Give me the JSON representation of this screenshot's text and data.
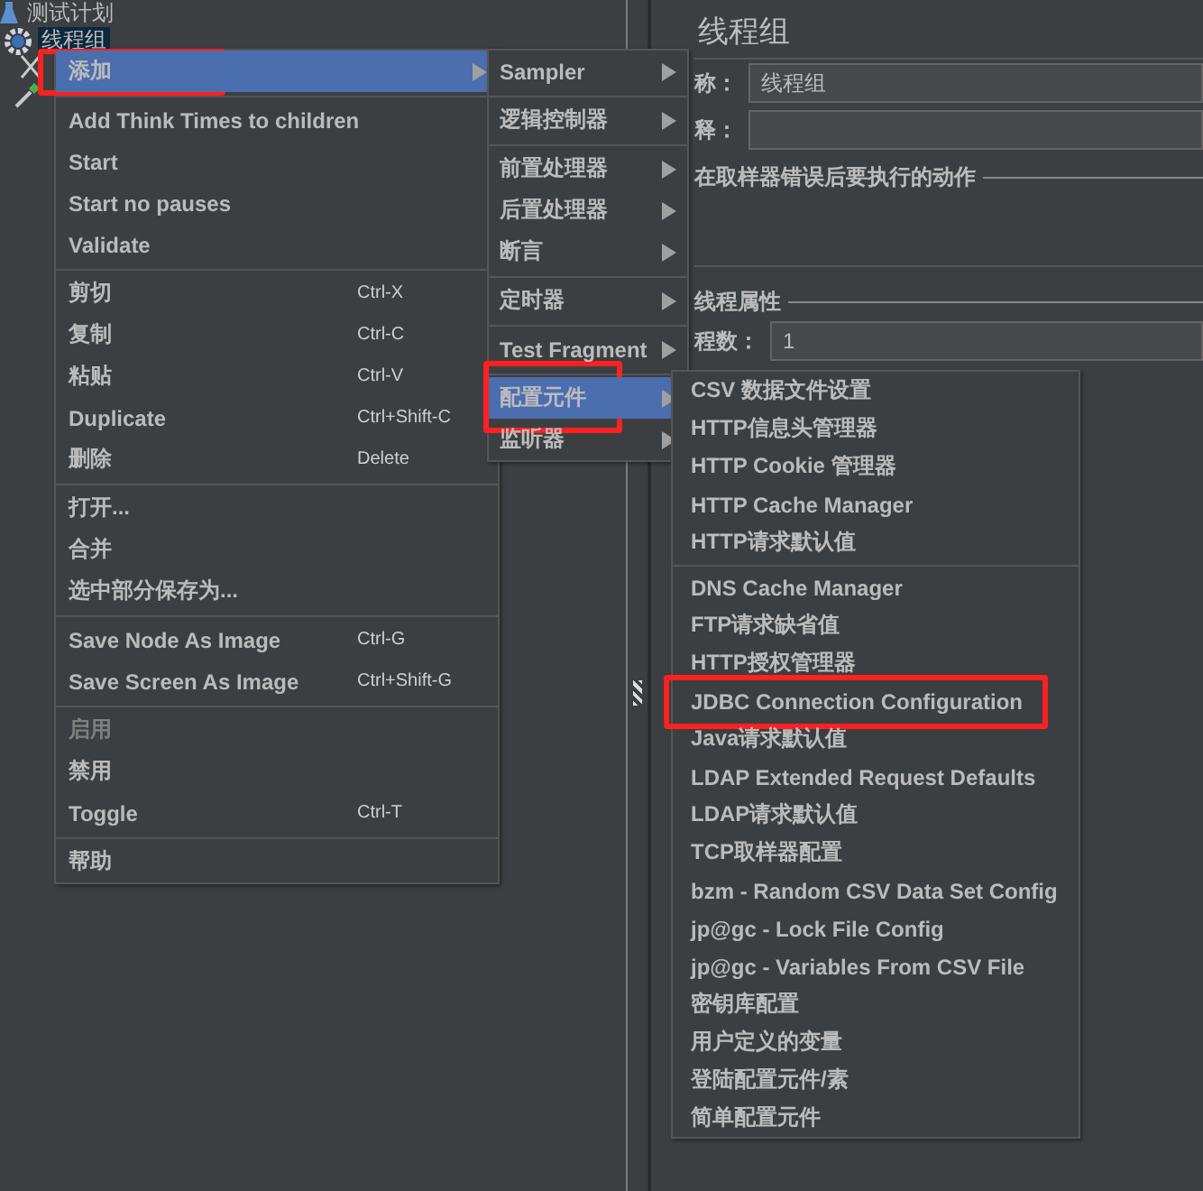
{
  "tree": {
    "items": [
      {
        "label": "测试计划",
        "selected": false
      },
      {
        "label": "线程组",
        "selected": true
      }
    ]
  },
  "panel": {
    "title": "线程组",
    "name_label": "称：",
    "name_value": "线程组",
    "comment_label": "释：",
    "error_action_title": "在取样器错误后要执行的动作",
    "thread_props_title": "线程属性",
    "threads_label": "程数：",
    "threads_value": "1"
  },
  "menus": [
    {
      "items": [
        {
          "kind": "submenu",
          "label": "添加",
          "selected": true,
          "marked": true
        },
        {
          "kind": "separator"
        },
        {
          "kind": "item",
          "label": "Add Think Times to children"
        },
        {
          "kind": "item",
          "label": "Start"
        },
        {
          "kind": "item",
          "label": "Start no pauses"
        },
        {
          "kind": "item",
          "label": "Validate"
        },
        {
          "kind": "separator"
        },
        {
          "kind": "item",
          "label": "剪切",
          "shortcut": "Ctrl-X"
        },
        {
          "kind": "item",
          "label": "复制",
          "shortcut": "Ctrl-C"
        },
        {
          "kind": "item",
          "label": "粘贴",
          "shortcut": "Ctrl-V"
        },
        {
          "kind": "item",
          "label": "Duplicate",
          "shortcut": "Ctrl+Shift-C"
        },
        {
          "kind": "item",
          "label": "删除",
          "shortcut": "Delete"
        },
        {
          "kind": "separator"
        },
        {
          "kind": "item",
          "label": "打开..."
        },
        {
          "kind": "item",
          "label": "合并"
        },
        {
          "kind": "item",
          "label": "选中部分保存为..."
        },
        {
          "kind": "separator"
        },
        {
          "kind": "item",
          "label": "Save Node As Image",
          "shortcut": "Ctrl-G"
        },
        {
          "kind": "item",
          "label": "Save Screen As Image",
          "shortcut": "Ctrl+Shift-G"
        },
        {
          "kind": "separator"
        },
        {
          "kind": "item",
          "label": "启用",
          "disabled": true
        },
        {
          "kind": "item",
          "label": "禁用"
        },
        {
          "kind": "item",
          "label": "Toggle",
          "shortcut": "Ctrl-T"
        },
        {
          "kind": "separator"
        },
        {
          "kind": "item",
          "label": "帮助"
        }
      ]
    },
    {
      "items": [
        {
          "kind": "submenu",
          "label": "Sampler"
        },
        {
          "kind": "separator"
        },
        {
          "kind": "submenu",
          "label": "逻辑控制器"
        },
        {
          "kind": "separator"
        },
        {
          "kind": "submenu",
          "label": "前置处理器"
        },
        {
          "kind": "submenu",
          "label": "后置处理器"
        },
        {
          "kind": "submenu",
          "label": "断言"
        },
        {
          "kind": "separator"
        },
        {
          "kind": "submenu",
          "label": "定时器"
        },
        {
          "kind": "separator"
        },
        {
          "kind": "submenu",
          "label": "Test Fragment"
        },
        {
          "kind": "separator"
        },
        {
          "kind": "submenu",
          "label": "配置元件",
          "selected": true,
          "marked": true
        },
        {
          "kind": "submenu",
          "label": "监听器"
        }
      ]
    },
    {
      "items": [
        {
          "kind": "item",
          "label": "CSV 数据文件设置"
        },
        {
          "kind": "item",
          "label": "HTTP信息头管理器"
        },
        {
          "kind": "item",
          "label": "HTTP Cookie 管理器"
        },
        {
          "kind": "item",
          "label": "HTTP Cache Manager"
        },
        {
          "kind": "item",
          "label": "HTTP请求默认值"
        },
        {
          "kind": "separator"
        },
        {
          "kind": "item",
          "label": "DNS Cache Manager"
        },
        {
          "kind": "item",
          "label": "FTP请求缺省值"
        },
        {
          "kind": "item",
          "label": "HTTP授权管理器"
        },
        {
          "kind": "item",
          "label": "JDBC Connection Configuration",
          "marked": true
        },
        {
          "kind": "item",
          "label": "Java请求默认值"
        },
        {
          "kind": "item",
          "label": "LDAP Extended Request Defaults"
        },
        {
          "kind": "item",
          "label": "LDAP请求默认值"
        },
        {
          "kind": "item",
          "label": "TCP取样器配置"
        },
        {
          "kind": "item",
          "label": "bzm - Random CSV Data Set Config"
        },
        {
          "kind": "item",
          "label": "jp@gc - Lock File Config"
        },
        {
          "kind": "item",
          "label": "jp@gc - Variables From CSV File"
        },
        {
          "kind": "item",
          "label": "密钥库配置"
        },
        {
          "kind": "item",
          "label": "用户定义的变量"
        },
        {
          "kind": "item",
          "label": "登陆配置元件/素"
        },
        {
          "kind": "item",
          "label": "简单配置元件"
        }
      ]
    }
  ]
}
